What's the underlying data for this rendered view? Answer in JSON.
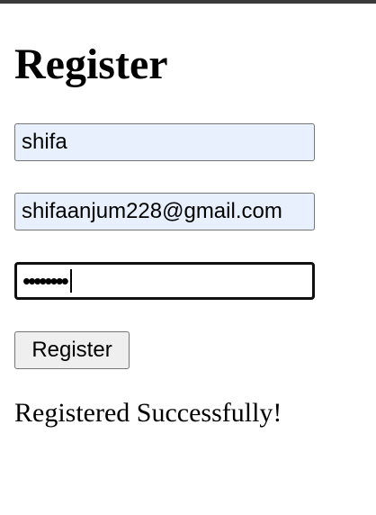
{
  "form": {
    "title": "Register",
    "name_value": "shifa",
    "email_value": "shifaanjum228@gmail.com",
    "password_masked": "••••••••",
    "submit_label": "Register"
  },
  "status": {
    "message": "Registered Successfully!"
  }
}
